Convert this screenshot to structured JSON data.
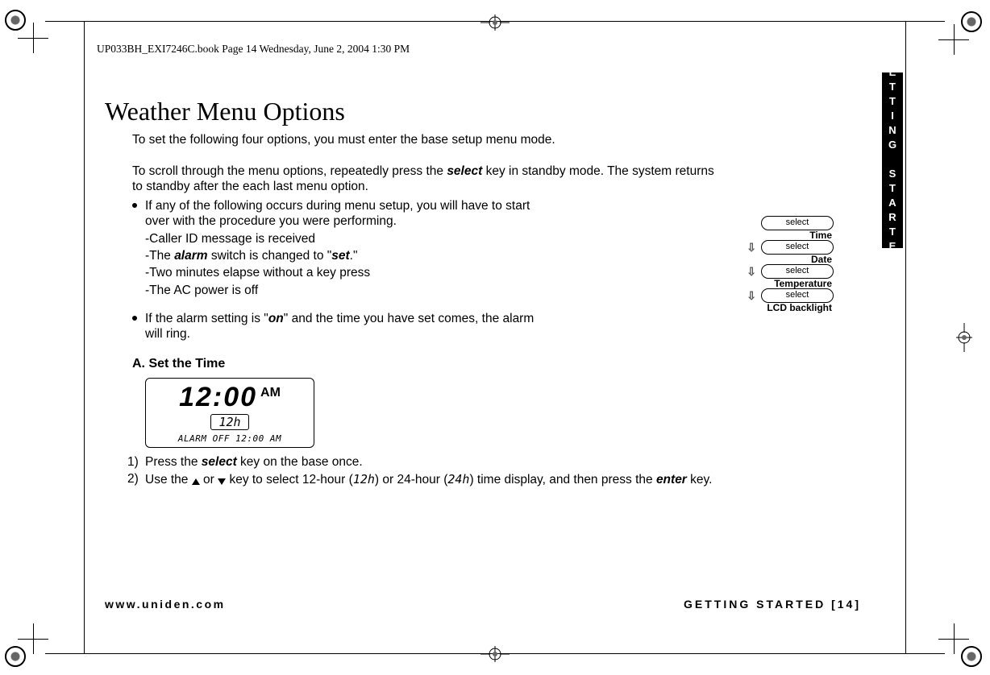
{
  "print_header": "UP033BH_EXI7246C.book  Page 14  Wednesday, June 2, 2004  1:30 PM",
  "side_tab": "GETTING STARTED",
  "title": "Weather Menu Options",
  "intro": "To set the following four options, you must enter the base setup menu mode.",
  "para2_a": "To scroll through the menu options, repeatedly press the ",
  "para2_key": "select",
  "para2_b": " key in standby mode. The system returns to standby after the each last menu option.",
  "bullet1_lead": "If any of the following occurs during menu setup, you will have to start over with the procedure you were performing.",
  "bullet1_sub1": "-Caller ID message is received",
  "bullet1_sub2_a": "-The ",
  "bullet1_sub2_alarm": "alarm",
  "bullet1_sub2_b": " switch is changed to \"",
  "bullet1_sub2_set": "set",
  "bullet1_sub2_c": ".\"",
  "bullet1_sub3": "-Two minutes elapse without a key press",
  "bullet1_sub4": "-The AC power is off",
  "bullet2_a": "If the alarm setting is \"",
  "bullet2_on": "on",
  "bullet2_b": "\" and the time you have set comes, the alarm will ring.",
  "section_a": "A. Set the Time",
  "lcd": {
    "time": "12:00",
    "am": "AM",
    "mode": "12h",
    "bottom": "ALARM OFF 12:00 AM"
  },
  "step1_a": "Press the ",
  "step1_key": "select",
  "step1_b": " key on the base once.",
  "step2_a": "Use the ",
  "step2_b": " or ",
  "step2_c": "  key to select 12-hour (",
  "step2_12h": "12h",
  "step2_d": ") or 24-hour (",
  "step2_24h": "24h",
  "step2_e": ") time display, and then press the ",
  "step2_enter": "enter",
  "step2_f": " key.",
  "cycle": {
    "pill": "select",
    "items": [
      "Time",
      "Date",
      "Temperature",
      "LCD backlight"
    ]
  },
  "footer_left": "www.uniden.com",
  "footer_right": "GETTING STARTED [14]"
}
